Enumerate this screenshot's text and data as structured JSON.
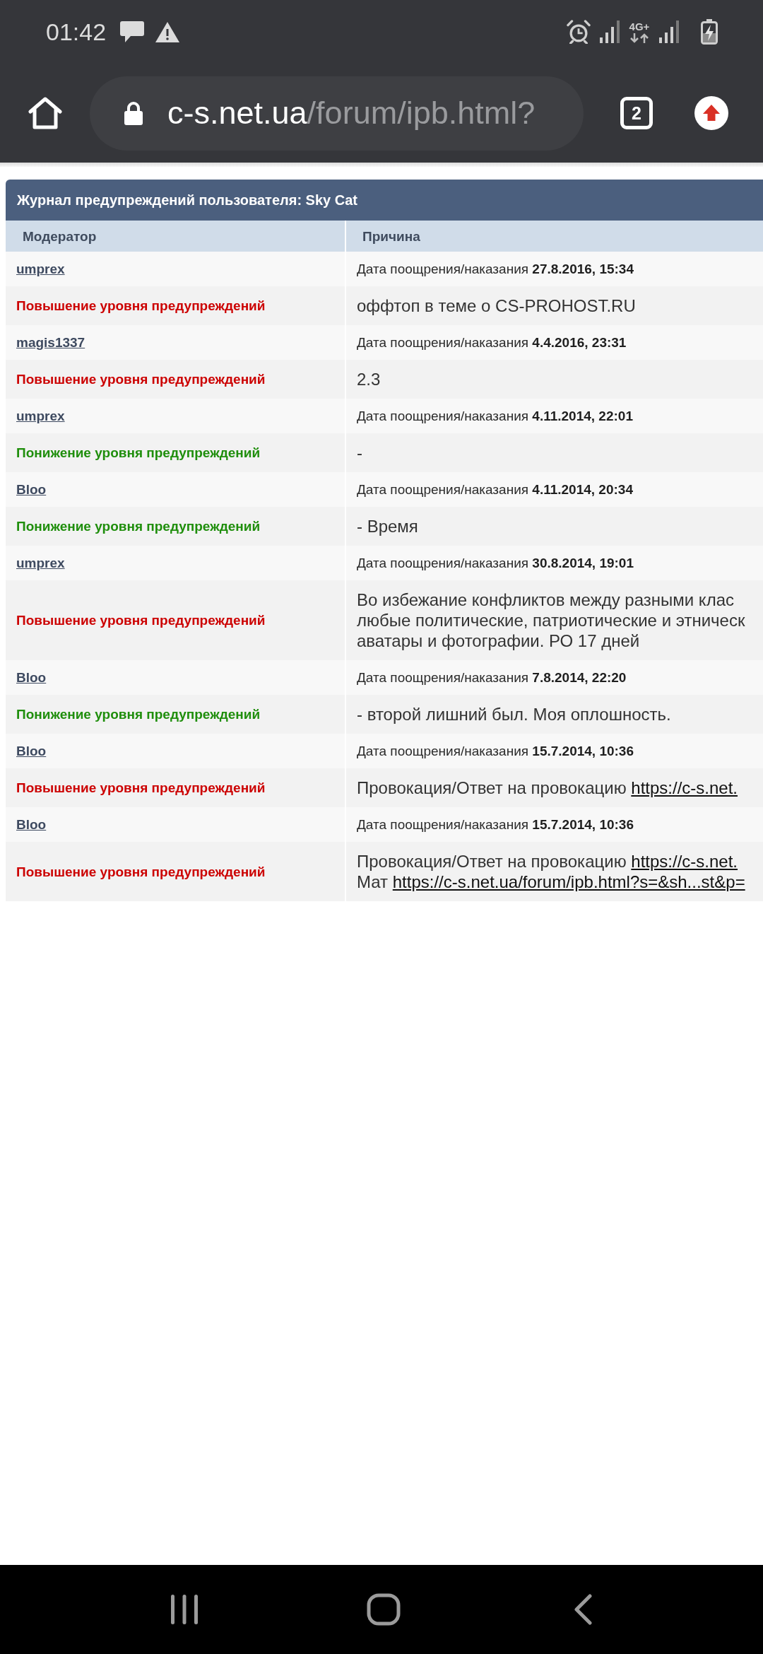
{
  "status_bar": {
    "time": "01:42",
    "network": "4G+"
  },
  "browser": {
    "url_host": "c-s.net.ua",
    "url_path": "/forum/ipb.html?",
    "tab_count": "2"
  },
  "log": {
    "title": "Журнал предупреждений пользователя: Sky Cat",
    "columns": [
      "Модератор",
      "Причина"
    ],
    "entries": [
      {
        "moderator": "umprex",
        "meta": "Дата поощрения/наказания **27.8.2016, 15:34**",
        "action": {
          "kind": "increase",
          "text": "Повышение уровня предупреждений"
        },
        "reason": [
          [
            {
              "kind": "text",
              "text": "оффтоп в теме о CS-PROHOST.RU"
            }
          ]
        ]
      },
      {
        "moderator": "magis1337",
        "meta": "Дата поощрения/наказания **4.4.2016, 23:31**",
        "action": {
          "kind": "increase",
          "text": "Повышение уровня предупреждений"
        },
        "reason": [
          [
            {
              "kind": "text",
              "text": "2.3"
            }
          ]
        ]
      },
      {
        "moderator": "umprex",
        "meta": "Дата поощрения/наказания **4.11.2014, 22:01**",
        "action": {
          "kind": "decrease",
          "text": "Понижение уровня предупреждений"
        },
        "reason": [
          [
            {
              "kind": "text",
              "text": "-"
            }
          ]
        ]
      },
      {
        "moderator": "Bloo",
        "meta": "Дата поощрения/наказания **4.11.2014, 20:34**",
        "action": {
          "kind": "decrease",
          "text": "Понижение уровня предупреждений"
        },
        "reason": [
          [
            {
              "kind": "text",
              "text": "- Время"
            }
          ]
        ]
      },
      {
        "moderator": "umprex",
        "meta": "Дата поощрения/наказания **30.8.2014, 19:01**",
        "action": {
          "kind": "increase",
          "text": "Повышение уровня предупреждений"
        },
        "reason": [
          [
            {
              "kind": "text",
              "text": "Во избежание конфликтов между разными клас"
            }
          ],
          [
            {
              "kind": "text",
              "text": "любые политические, патриотические и этническ"
            }
          ],
          [
            {
              "kind": "text",
              "text": "аватары и фотографии. РО 17 дней"
            }
          ]
        ]
      },
      {
        "moderator": "Bloo",
        "meta": "Дата поощрения/наказания **7.8.2014, 22:20**",
        "action": {
          "kind": "decrease",
          "text": "Понижение уровня предупреждений"
        },
        "reason": [
          [
            {
              "kind": "text",
              "text": "- второй лишний был. Моя оплошность."
            }
          ]
        ]
      },
      {
        "moderator": "Bloo",
        "meta": "Дата поощрения/наказания **15.7.2014, 10:36**",
        "action": {
          "kind": "increase",
          "text": "Повышение уровня предупреждений"
        },
        "reason": [
          [
            {
              "kind": "text",
              "text": "Провокация/Ответ на провокацию"
            },
            {
              "kind": "link",
              "text": "https://c-s.net."
            }
          ]
        ]
      },
      {
        "moderator": "Bloo",
        "meta": "Дата поощрения/наказания **15.7.2014, 10:36**",
        "action": {
          "kind": "increase",
          "text": "Повышение уровня предупреждений"
        },
        "reason": [
          [
            {
              "kind": "text",
              "text": "Провокация/Ответ на провокацию"
            },
            {
              "kind": "link",
              "text": "https://c-s.net."
            }
          ],
          [
            {
              "kind": "text",
              "text": "Мат"
            },
            {
              "kind": "link",
              "text": "https://c-s.net.ua/forum/ipb.html?s=&sh...st&p="
            }
          ]
        ]
      }
    ]
  }
}
